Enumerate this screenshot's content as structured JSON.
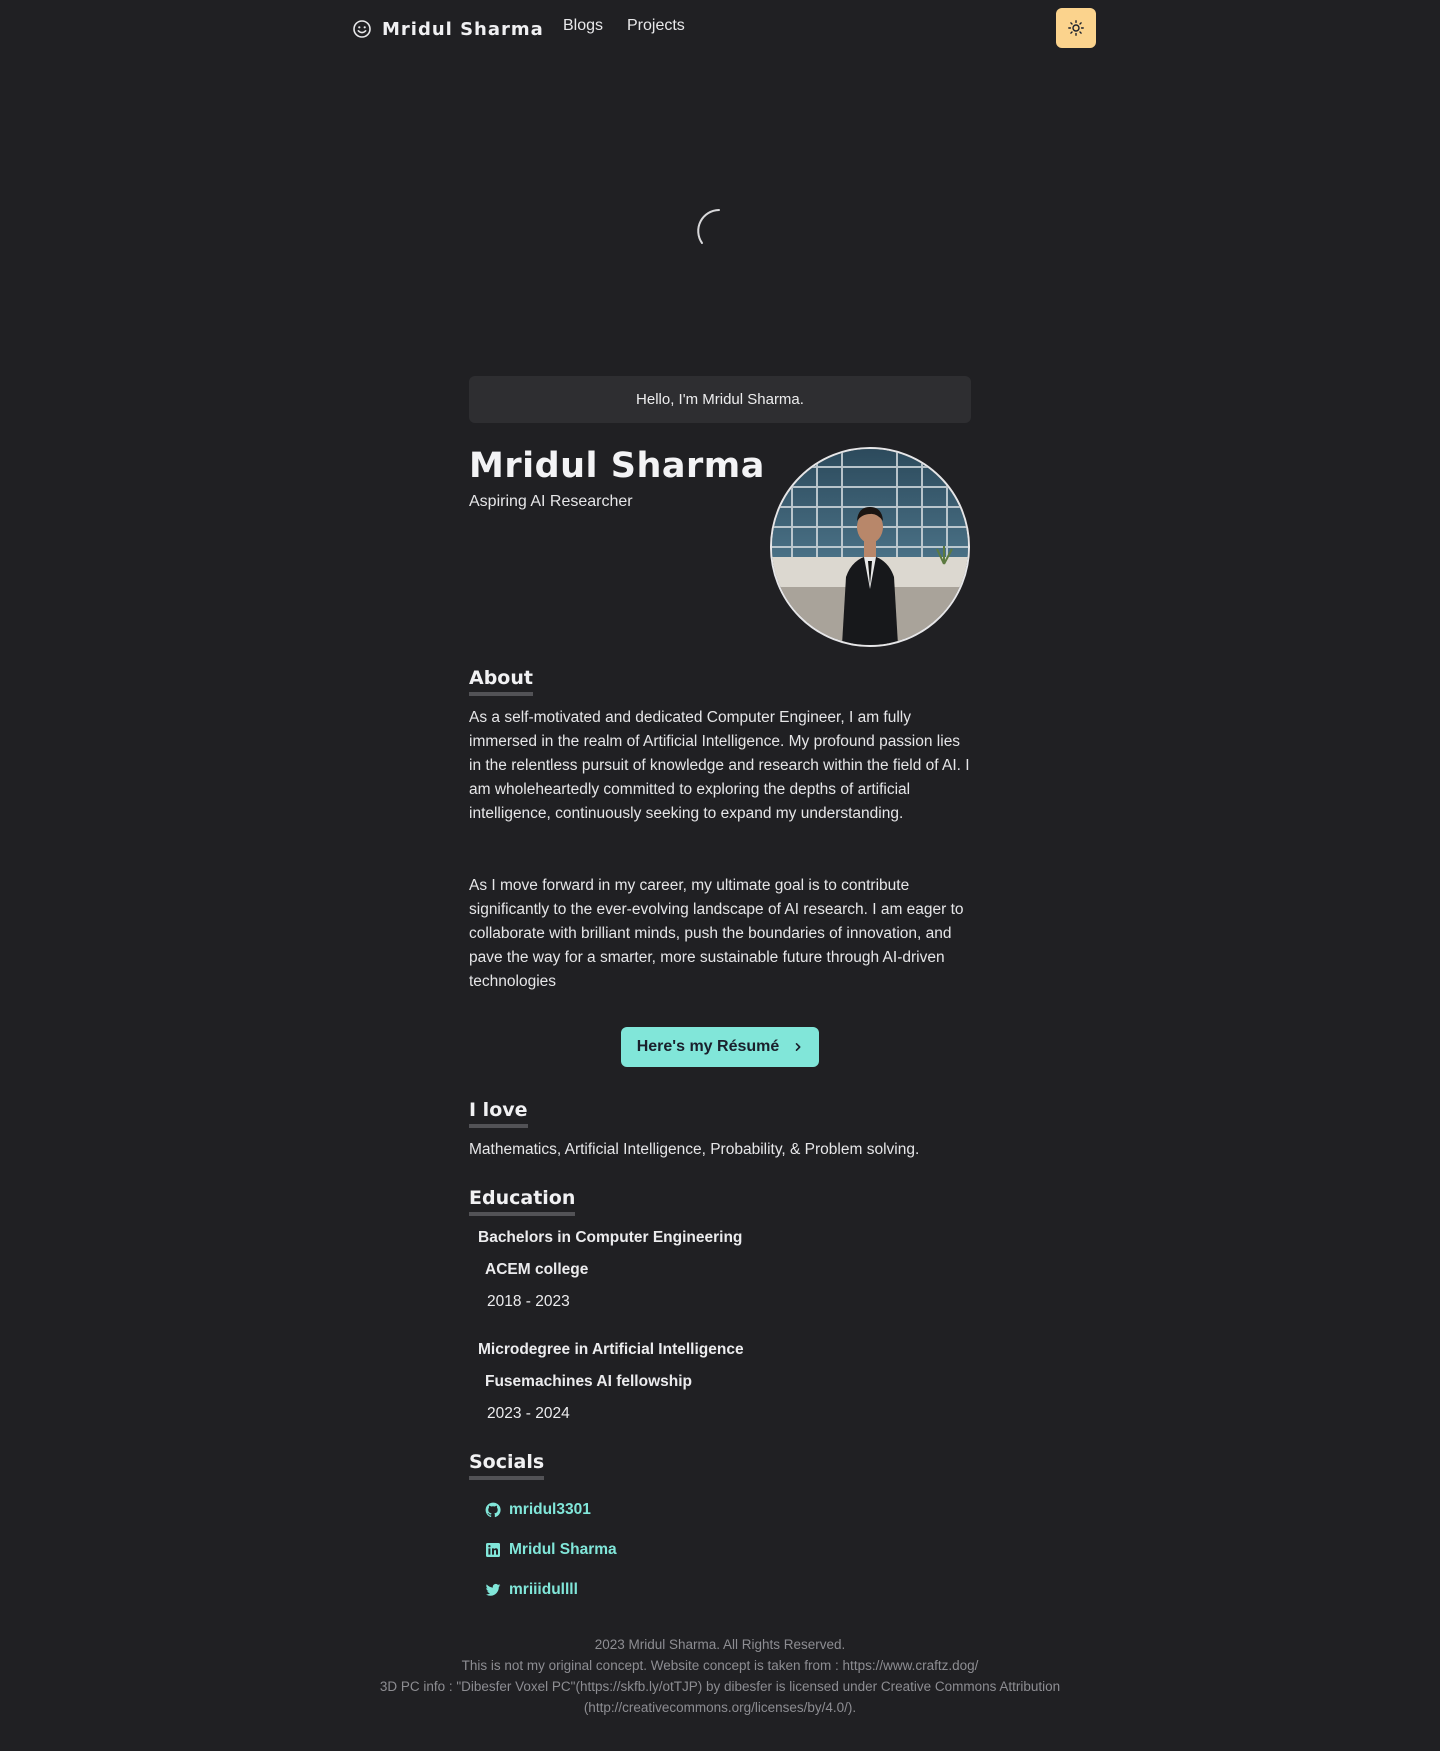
{
  "nav": {
    "brand": "Mridul Sharma",
    "links": [
      "Blogs",
      "Projects"
    ],
    "theme_toggle_icon": "sun-icon"
  },
  "hero": {
    "greeting": "Hello, I'm Mridul Sharma.",
    "name": "Mridul Sharma",
    "role": "Aspiring AI Researcher"
  },
  "about": {
    "heading": "About",
    "paragraphs": [
      "As a self-motivated and dedicated Computer Engineer, I am fully immersed in the realm of Artificial Intelligence. My profound passion lies in the relentless pursuit of knowledge and research within the field of AI. I am wholeheartedly committed to exploring the depths of artificial intelligence, continuously seeking to expand my understanding.",
      "As I move forward in my career, my ultimate goal is to contribute significantly to the ever-evolving landscape of AI research. I am eager to collaborate with brilliant minds, push the boundaries of innovation, and pave the way for a smarter, more sustainable future through AI-driven technologies"
    ],
    "resume_button": "Here's my Résumé"
  },
  "love": {
    "heading": "I love",
    "text": "Mathematics, Artificial Intelligence, Probability, & Problem solving."
  },
  "education": {
    "heading": "Education",
    "items": [
      {
        "degree": "Bachelors in Computer Engineering",
        "school": "ACEM college",
        "years": "2018 - 2023"
      },
      {
        "degree": "Microdegree in Artificial Intelligence",
        "school": "Fusemachines AI fellowship",
        "years": "2023 - 2024"
      }
    ]
  },
  "socials": {
    "heading": "Socials",
    "items": [
      {
        "icon": "github-icon",
        "label": "mridul3301"
      },
      {
        "icon": "linkedin-icon",
        "label": "Mridul Sharma"
      },
      {
        "icon": "twitter-icon",
        "label": "mriiidullll"
      }
    ]
  },
  "footer": {
    "lines": [
      "2023 Mridul Sharma. All Rights Reserved.",
      "This is not my original concept. Website concept is taken from : https://www.craftz.dog/",
      "3D PC info : \"Dibesfer Voxel PC\"(https://skfb.ly/otTJP) by dibesfer is licensed under Creative Commons Attribution",
      "(http://creativecommons.org/licenses/by/4.0/)."
    ]
  },
  "colors": {
    "background": "#202023",
    "accent": "#81e6d9",
    "theme_button": "#fbd38d"
  }
}
